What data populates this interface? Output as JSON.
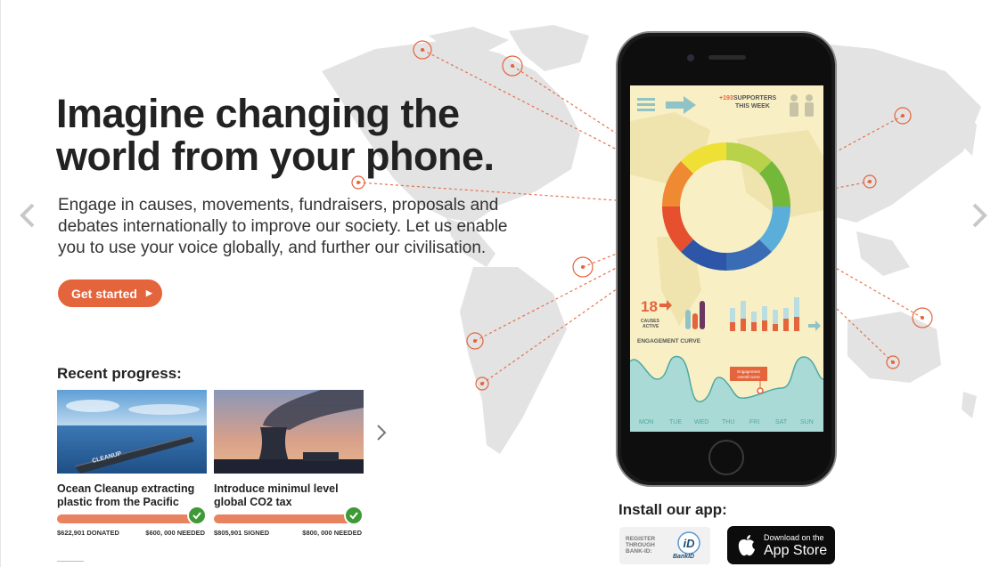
{
  "hero": {
    "headline": "Imagine changing the world from your phone.",
    "intro": "Engage in causes, movements, fundraisers, proposals and debates internationally to improve our society. Let us enable you to use your voice globally, and further our civilisation.",
    "cta_label": "Get started"
  },
  "progress": {
    "heading": "Recent progress:",
    "cards": [
      {
        "title": "Ocean Cleanup extracting plastic from the Pacific",
        "stat_left": "$622,901 DONATED",
        "stat_right": "$600, 000 NEEDED",
        "image_text": "CLEANUP",
        "complete": 1.0
      },
      {
        "title": "Introduce minimul level global CO2 tax",
        "stat_left": "$805,901 SIGNED",
        "stat_right": "$800, 000 NEEDED",
        "complete": 1.0
      }
    ]
  },
  "app_screen": {
    "supporters_count": "+193",
    "supporters_label_1": "SUPPORTERS",
    "supporters_label_2": "THIS WEEK",
    "causes_count": "18",
    "causes_label_1": "CAUSES",
    "causes_label_2": "ACTIVE",
    "engagement_label": "ENGAGEMENT CURVE",
    "tooltip_1": "Engagement",
    "tooltip_2": "overall curve",
    "days": [
      "MON",
      "TUE",
      "WED",
      "THU",
      "FRI",
      "SAT",
      "SUN"
    ]
  },
  "install": {
    "title": "Install our app:",
    "bankid_text_1": "REGISTER",
    "bankid_text_2": "THROUGH",
    "bankid_text_3": "BANK-ID:",
    "bankid_label": "BankID",
    "appstore_small": "Download on the",
    "appstore_big": "App Store"
  },
  "colors": {
    "accent": "#e4643b",
    "success": "#3e9a36",
    "map": "#e3e3e3",
    "screen_bg": "#f9efc4"
  },
  "icons": [
    "chevron-left-icon",
    "chevron-right-icon",
    "check-icon",
    "apple-icon",
    "bankid-icon",
    "menu-icon",
    "arrow-icon",
    "people-icon"
  ]
}
